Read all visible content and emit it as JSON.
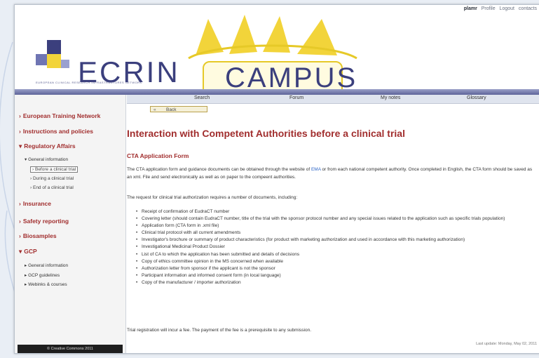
{
  "top_links": {
    "user": "plamr",
    "profile": "Profile",
    "logout": "Logout",
    "contacts": "contacts"
  },
  "header": {
    "logo_text": "ECRIN",
    "logo_tagline": "EUROPEAN CLINICAL RESEARCH INFRASTRUCTURES NETWORK",
    "campus_text": "CAMPUS",
    "colors": {
      "logo_blue": "#3b3f7d",
      "accent_yellow": "#f2d43a",
      "brand_red": "#a12e2e"
    }
  },
  "nav": {
    "items": [
      "Search",
      "Forum",
      "My notes",
      "Glossary"
    ]
  },
  "back_button": {
    "label": "Back",
    "icon": "double-chevron-left-icon"
  },
  "sidebar": {
    "items": [
      {
        "label": "European Training Network",
        "arrow": "›"
      },
      {
        "label": "Instructions and policies",
        "arrow": "›"
      },
      {
        "label": "Regulatory Affairs",
        "arrow": "▾"
      },
      {
        "label": "Insurance",
        "arrow": "›"
      },
      {
        "label": "Safety reporting",
        "arrow": "›"
      },
      {
        "label": "Biosamples",
        "arrow": "›"
      },
      {
        "label": "GCP",
        "arrow": "▾"
      }
    ],
    "regulatory_sub": {
      "label": "General information",
      "arrow": "▾"
    },
    "regulatory_children": [
      {
        "label": "Before a clinical trial",
        "arrow": "›",
        "active": true
      },
      {
        "label": "During a clinical trial",
        "arrow": "›"
      },
      {
        "label": "End of a clinical trial",
        "arrow": "›"
      }
    ],
    "gcp_children": [
      {
        "label": "General information",
        "arrow": "▸"
      },
      {
        "label": "GCP guidelines",
        "arrow": "▸"
      },
      {
        "label": "Webinks & courses",
        "arrow": "▸"
      }
    ],
    "copyright": "© Creative Commons 2011"
  },
  "content": {
    "title": "Interaction with Competent Authorities before a clinical trial",
    "subtitle": "CTA Application Form",
    "para1_a": "The CTA application form and guidance documents can be obtained through the website of ",
    "para1_link": "EMA",
    "para1_b": " or from each national competent authority. Once completed in English, the CTA form should be saved as an xml. File and send electronically as well as on paper to the compeent authorities.",
    "para2": "The request for clinical trial authorization requires a number of documents, including:",
    "documents": [
      "Receipt of confirmation of EudraCT number",
      "Covering letter (should contain EudraCT number, title of the trial with the sponsor protocol number and any special issues related to the application such as specific trials population)",
      "Application form (CTA form in .xml file)",
      "Clinical trial protocol with all current amendments",
      "Investigator's brochure or summary of product characteristics (for product with marketing authorization and used in accordance with this marketing authorization)",
      "Investigational Medicinal Product Dossier",
      "List of CA to which the application has been submitted and details of decisions",
      "Copy of ethics committee opinion in the MS concerned when available",
      "Authorization letter from sponsor if the applicant is not the sponsor",
      "Participant information and informed consent form (in local language)",
      "Copy of the manufacturer / importer authorization"
    ],
    "para3": "Trial registration will incur a fee. The payment of the fee is a prerequisite to any submission.",
    "last_update": "Last update: Monday, May 02, 2011"
  }
}
